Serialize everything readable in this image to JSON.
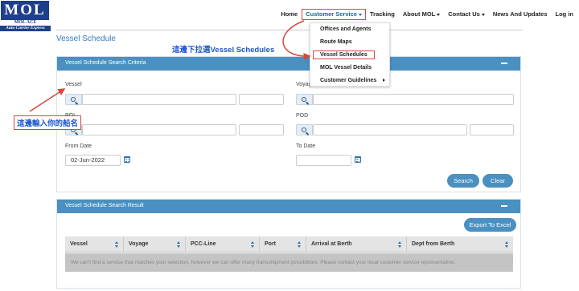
{
  "logo": {
    "mark": "MOL",
    "line1": "MOL ACE",
    "line2": "Auto Carrier Express"
  },
  "nav": {
    "home": "Home",
    "customer_service": "Customer Service",
    "tracking": "Tracking",
    "about": "About MOL",
    "contact": "Contact Us",
    "news": "News And Updates",
    "login": "Log in"
  },
  "dropdown": {
    "items": [
      "Offices and Agents",
      "Route Maps",
      "Vessel Schedules",
      "MOL Vessel Details",
      "Customer Guidelines"
    ]
  },
  "page": {
    "title": "Vessel Schedule"
  },
  "criteria": {
    "heading": "Vessel Schedule Search Criteria",
    "vessel_label": "Vessel",
    "voyage_label": "Voyage",
    "pol_label": "POL",
    "pod_label": "POD",
    "from_date_label": "From Date",
    "from_date_value": "02-Jun-2022",
    "to_date_label": "To Date",
    "to_date_value": "",
    "search_button": "Search",
    "clear_button": "Clear"
  },
  "results": {
    "heading": "Vessel Schedule Search Result",
    "export_button": "Export To Excel",
    "columns": [
      "Vessel",
      "Voyage",
      "PCC-Line",
      "Port",
      "Arrival at Berth",
      "Dept from Berth"
    ],
    "empty_message": "We can't find a service that matches your selection, however we can offer many transshipment possibilities. Please contact your local customer service representative."
  },
  "annotations": {
    "dropdown_note": "這邊下拉選Vessel Schedules",
    "vessel_note": "這邊輸入你的船名"
  },
  "colors": {
    "brand": "#1e3f8a",
    "accent": "#4a90c0",
    "annotation_red": "#d9463a",
    "annotation_blue": "#1d57c9"
  }
}
